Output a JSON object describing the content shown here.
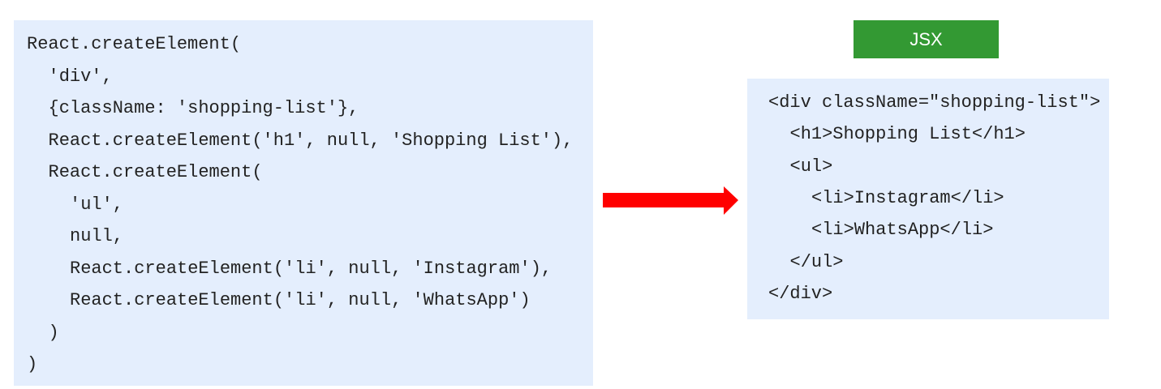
{
  "left_code": {
    "lines": [
      {
        "indent": 0,
        "text": "React.createElement("
      },
      {
        "indent": 1,
        "text": "'div',"
      },
      {
        "indent": 1,
        "text": "{className: 'shopping-list'},"
      },
      {
        "indent": 1,
        "text": "React.createElement('h1', null, 'Shopping List'),"
      },
      {
        "indent": 1,
        "text": "React.createElement("
      },
      {
        "indent": 2,
        "text": "'ul',"
      },
      {
        "indent": 2,
        "text": "null,"
      },
      {
        "indent": 2,
        "text": "React.createElement('li', null, 'Instagram'),"
      },
      {
        "indent": 2,
        "text": "React.createElement('li', null, 'WhatsApp')"
      },
      {
        "indent": 1,
        "text": ")"
      },
      {
        "indent": 0,
        "text": ")"
      }
    ]
  },
  "jsx_label": "JSX",
  "right_code": {
    "lines": [
      {
        "indent": 0,
        "text": "<div className=\"shopping-list\">"
      },
      {
        "indent": 1,
        "text": "<h1>Shopping List</h1>"
      },
      {
        "indent": 1,
        "text": "<ul>"
      },
      {
        "indent": 2,
        "text": "<li>Instagram</li>"
      },
      {
        "indent": 2,
        "text": "<li>WhatsApp</li>"
      },
      {
        "indent": 1,
        "text": "</ul>"
      },
      {
        "indent": 0,
        "text": "</div>"
      }
    ]
  },
  "colors": {
    "panel": "#e4eefd",
    "label": "#339933",
    "arrow": "#ff0000"
  },
  "icons": {
    "arrow": "arrow-right-icon"
  }
}
